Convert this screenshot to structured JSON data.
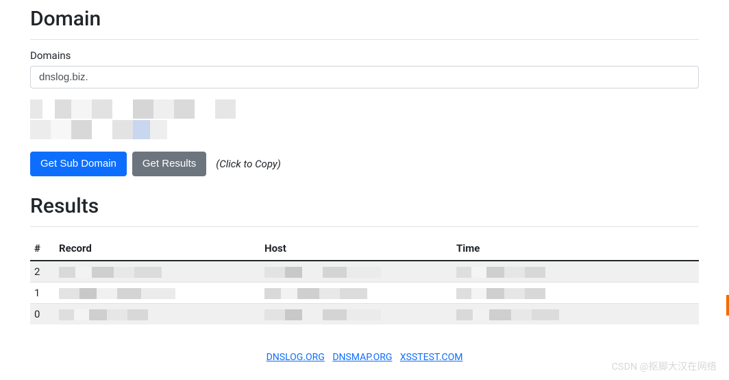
{
  "domain": {
    "title": "Domain",
    "label": "Domains",
    "value": "dnslog.biz."
  },
  "buttons": {
    "get_sub": "Get Sub Domain",
    "get_results": "Get Results",
    "hint": "(Click to Copy)"
  },
  "results": {
    "title": "Results",
    "headers": {
      "num": "#",
      "record": "Record",
      "host": "Host",
      "time": "Time"
    },
    "rows": [
      {
        "num": "2"
      },
      {
        "num": "1"
      },
      {
        "num": "0"
      }
    ]
  },
  "footer": {
    "links": [
      {
        "label": "DNSLOG.ORG"
      },
      {
        "label": "DNSMAP.ORG"
      },
      {
        "label": "XSSTEST.COM"
      }
    ]
  },
  "watermark": "CSDN @抠脚大汉在网络"
}
